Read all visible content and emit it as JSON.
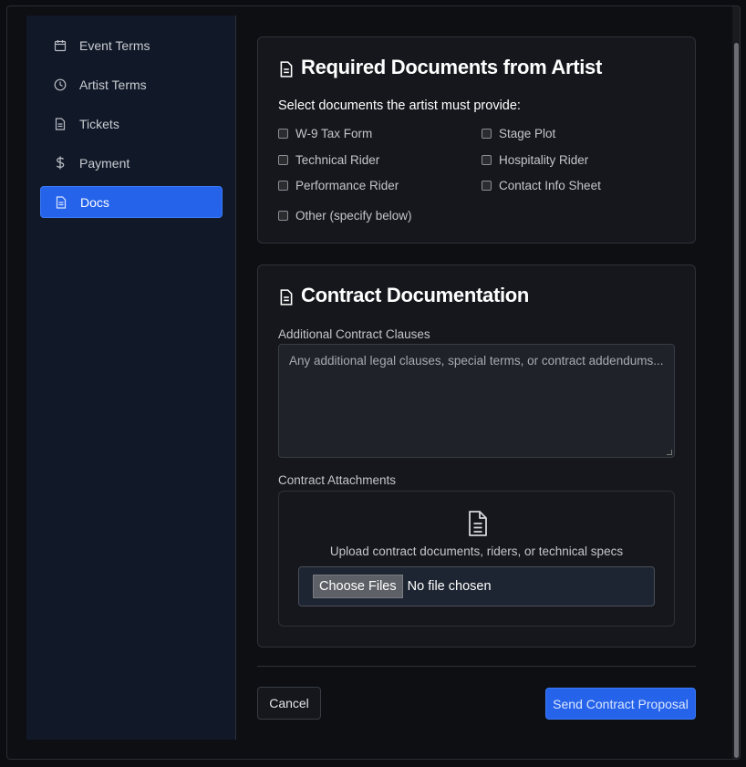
{
  "sidebar": {
    "items": [
      {
        "label": "Event Terms",
        "icon": "calendar-icon"
      },
      {
        "label": "Artist Terms",
        "icon": "clock-icon"
      },
      {
        "label": "Tickets",
        "icon": "document-icon"
      },
      {
        "label": "Payment",
        "icon": "dollar-icon"
      },
      {
        "label": "Docs",
        "icon": "document-icon",
        "active": true
      }
    ]
  },
  "required_docs": {
    "title": "Required Documents from Artist",
    "prompt": "Select documents the artist must provide:",
    "options": [
      "W-9 Tax Form",
      "Stage Plot",
      "Technical Rider",
      "Hospitality Rider",
      "Performance Rider",
      "Contact Info Sheet",
      "Other (specify below)"
    ]
  },
  "contract_docs": {
    "title": "Contract Documentation",
    "clauses_label": "Additional Contract Clauses",
    "clauses_placeholder": "Any additional legal clauses, special terms, or contract addendums...",
    "attachments_label": "Contract Attachments",
    "upload_text": "Upload contract documents, riders, or technical specs",
    "file_button": "Choose Files",
    "file_status": "No file chosen"
  },
  "footer": {
    "cancel_label": "Cancel",
    "send_label": "Send Contract Proposal"
  },
  "colors": {
    "accent": "#2563eb",
    "background": "#0d0f13",
    "card": "#15171c",
    "sidebar": "#111827"
  }
}
